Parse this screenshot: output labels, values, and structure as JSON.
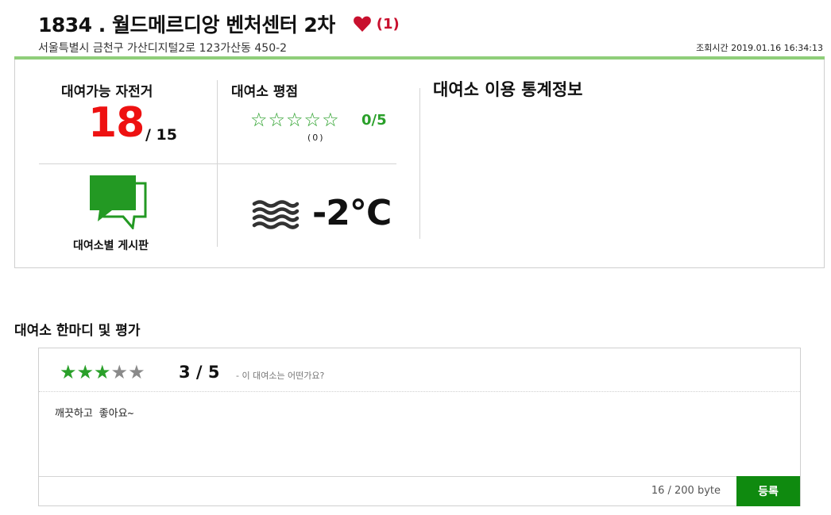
{
  "header": {
    "station_title": "1834 . 월드메르디앙 벤처센터 2차",
    "favorite_count": "(1)",
    "address": "서울특별시 금천구 가산디지털2로 123가산동 450-2",
    "lookup_time": "조회시간 2019.01.16 16:34:13"
  },
  "availability": {
    "label": "대여가능 자전거",
    "count": "18",
    "total": "/ 15"
  },
  "station_rating": {
    "label": "대여소 평점",
    "stars": "☆☆☆☆☆",
    "score": "0/5",
    "review_count": "(0)"
  },
  "board": {
    "label": "대여소별 게시판"
  },
  "weather": {
    "icon": "fog-icon",
    "temperature": "-2℃"
  },
  "stats": {
    "title": "대여소 이용 통계정보"
  },
  "review": {
    "heading": "대여소 한마디 및 평가",
    "rating_value": 3,
    "rating_max": 5,
    "score_text": "3 / 5",
    "hint": "- 이 대여소는 어떤가요?",
    "text": "깨끗하고 좋아요~",
    "byte_counter": "16 / 200 byte",
    "submit_label": "등록"
  },
  "colors": {
    "accent_green": "#2aa02a",
    "button_green": "#0f8a0f",
    "count_red": "#ee1111",
    "heart_red": "#c8102e",
    "rule_green": "#8fce7a"
  }
}
